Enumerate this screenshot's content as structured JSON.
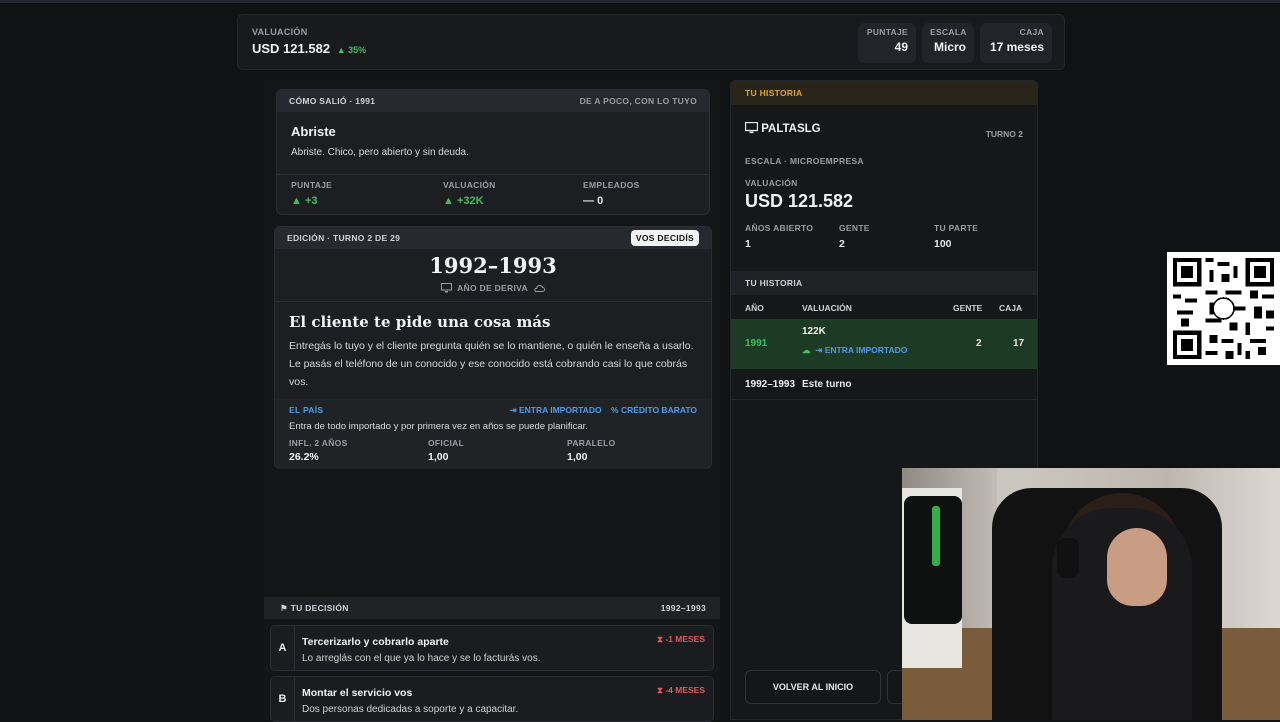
{
  "topbar": {
    "valuation_label": "VALUACIÓN",
    "valuation_value": "USD 121.582",
    "valuation_change": "▲ 35%",
    "stats": [
      {
        "label": "PUNTAJE",
        "value": "49"
      },
      {
        "label": "ESCALA",
        "value": "Micro"
      },
      {
        "label": "CAJA",
        "value": "17 meses"
      }
    ]
  },
  "result": {
    "header_left": "CÓMO SALIÓ · 1991",
    "header_right": "DE A POCO, CON LO TUYO",
    "title": "Abriste",
    "text": "Abriste. Chico, pero abierto y sin deuda.",
    "metrics": [
      {
        "label": "PUNTAJE",
        "icon": "▲",
        "value": "+3"
      },
      {
        "label": "VALUACIÓN",
        "icon": "▲",
        "value": "+32K"
      },
      {
        "label": "EMPLEADOS",
        "icon": "—",
        "value": "0"
      }
    ]
  },
  "edition": {
    "header": "EDICIÓN · TURNO 2 DE 29",
    "badge": "VOS DECIDÍS",
    "years": "1992–1993",
    "subtitle": "AÑO DE DERIVA",
    "headline": "El cliente te pide una cosa más",
    "body": "Entregás lo tuyo y el cliente pregunta quién se lo mantiene, o quién le enseña a usarlo. Le pasás el teléfono de un conocido y ese conocido está cobrando casi lo que cobrás vos.",
    "country_label": "EL PAÍS",
    "tag1": "ENTRA IMPORTADO",
    "tag2": "CRÉDITO BARATO",
    "country_text": "Entra de todo importado y por primera vez en años se puede planificar.",
    "indicators": [
      {
        "label": "INFL. 2 AÑOS",
        "value": "26.2%"
      },
      {
        "label": "OFICIAL",
        "value": "1,00"
      },
      {
        "label": "PARALELO",
        "value": "1,00"
      }
    ]
  },
  "decision": {
    "header": "TU DECISIÓN",
    "years": "1992–1993",
    "options": [
      {
        "letter": "A",
        "title": "Tercerizarlo y cobrarlo aparte",
        "desc": "Lo arreglás con el que ya lo hace y se lo facturás vos.",
        "cost": "-1 MESES"
      },
      {
        "letter": "B",
        "title": "Montar el servicio vos",
        "desc": "Dos personas dedicadas a soporte y a capacitar.",
        "cost": "-4 MESES"
      }
    ]
  },
  "story": {
    "header": "TU HISTORIA",
    "company": "PALTASLG",
    "turn": "TURNO 2",
    "scale": "ESCALA · MICROEMPRESA",
    "valuation_label": "VALUACIÓN",
    "valuation_value": "USD 121.582",
    "stats": [
      {
        "label": "AÑOS ABIERTO",
        "value": "1"
      },
      {
        "label": "GENTE",
        "value": "2"
      },
      {
        "label": "TU PARTE",
        "value": "100"
      }
    ],
    "history_header": "TU HISTORIA",
    "columns": [
      "AÑO",
      "VALUACIÓN",
      "GENTE",
      "CAJA"
    ],
    "row1": {
      "year": "1991",
      "valuation": "122K",
      "tag": "ENTRA IMPORTADO",
      "people": "2",
      "cash": "17"
    },
    "row2": {
      "year": "1992–1993",
      "label": "Este turno"
    },
    "back_button": "VOLVER AL INICIO"
  },
  "colors": {
    "accent_green": "#3fbf5f",
    "accent_blue": "#4f9be8",
    "accent_red": "#e05a5a",
    "accent_orange": "#e0a23a"
  }
}
